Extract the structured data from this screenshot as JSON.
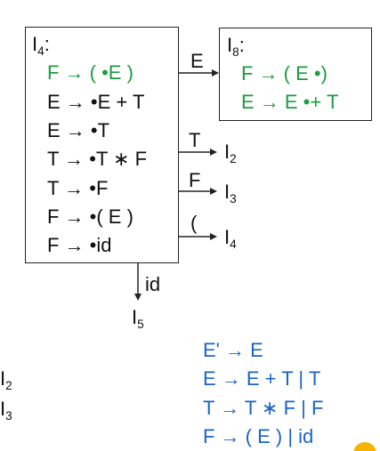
{
  "colors": {
    "green": "#1a9e3f",
    "blue": "#1a63c8",
    "orange": "#f5b400"
  },
  "state_i4": {
    "name": "I",
    "sub": "4",
    "colon": ":",
    "items": [
      {
        "text": "F → ( •E )",
        "color": "green"
      },
      {
        "text": "E → •E + T",
        "color": "black"
      },
      {
        "text": "E → •T",
        "color": "black"
      },
      {
        "text": "T → •T ∗ F",
        "color": "black"
      },
      {
        "text": "T → •F",
        "color": "black"
      },
      {
        "text": "F → •( E )",
        "color": "black"
      },
      {
        "text": "F → •id",
        "color": "black"
      }
    ]
  },
  "state_i8": {
    "name": "I",
    "sub": "8",
    "colon": ":",
    "items": [
      {
        "text": "F → ( E •)",
        "color": "green"
      },
      {
        "text": "E → E •+ T",
        "color": "green"
      }
    ]
  },
  "transitions": [
    {
      "symbol": "E",
      "target_name": "I",
      "target_sub": "8"
    },
    {
      "symbol": "T",
      "target_name": "I",
      "target_sub": "2"
    },
    {
      "symbol": "F",
      "target_name": "I",
      "target_sub": "3"
    },
    {
      "symbol": "(",
      "target_name": "I",
      "target_sub": "4"
    },
    {
      "symbol": "id",
      "target_name": "I",
      "target_sub": "5"
    }
  ],
  "left_labels": [
    {
      "name": "I",
      "sub": "2"
    },
    {
      "name": "I",
      "sub": "3"
    }
  ],
  "grammar": [
    "E' → E",
    "E → E + T | T",
    "T → T ∗ F | F",
    "F → ( E ) | id"
  ]
}
